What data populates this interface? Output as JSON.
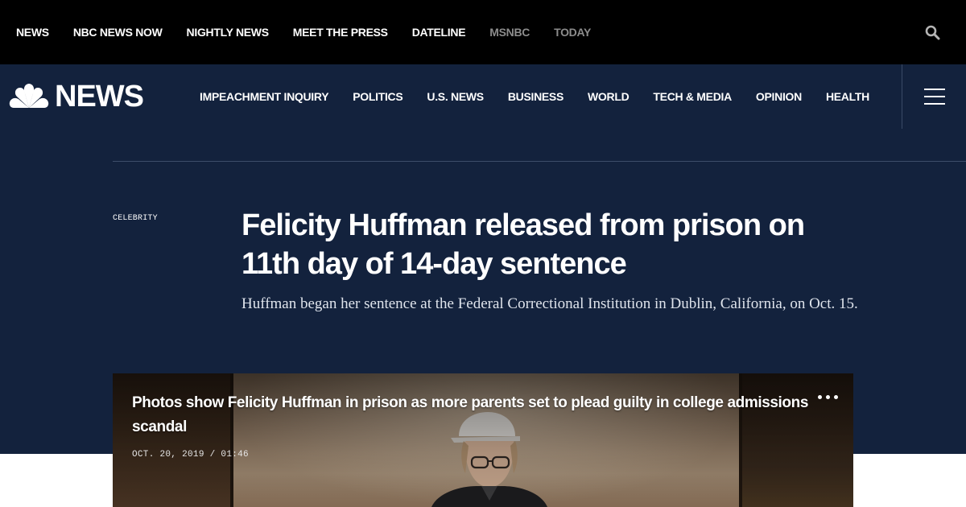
{
  "top_nav": {
    "items": [
      {
        "label": "NEWS",
        "dim": false
      },
      {
        "label": "NBC NEWS NOW",
        "dim": false
      },
      {
        "label": "NIGHTLY NEWS",
        "dim": false
      },
      {
        "label": "MEET THE PRESS",
        "dim": false
      },
      {
        "label": "DATELINE",
        "dim": false
      },
      {
        "label": "MSNBC",
        "dim": true
      },
      {
        "label": "TODAY",
        "dim": true
      }
    ],
    "search_icon": "search-icon"
  },
  "header": {
    "logo_text": "NEWS",
    "logo_icon": "peacock-icon",
    "sections": [
      "IMPEACHMENT INQUIRY",
      "POLITICS",
      "U.S. NEWS",
      "BUSINESS",
      "WORLD",
      "TECH & MEDIA",
      "OPINION",
      "HEALTH"
    ],
    "menu_icon": "hamburger-menu-icon"
  },
  "article": {
    "eyebrow": "CELEBRITY",
    "headline": "Felicity Huffman released from prison on 11th day of 14-day sentence",
    "dek": "Huffman began her sentence at the Federal Correctional Institution in Dublin, California, on Oct. 15."
  },
  "video": {
    "title": "Photos show Felicity Huffman in prison as more parents set to plead guilty in college admissions scandal",
    "date": "OCT. 20, 2019 / 01:46",
    "more_icon": "more-options-icon"
  },
  "colors": {
    "top_bar": "#000000",
    "header_bg": "#13223d",
    "dim_nav": "#8c8c8c",
    "text": "#ffffff"
  }
}
